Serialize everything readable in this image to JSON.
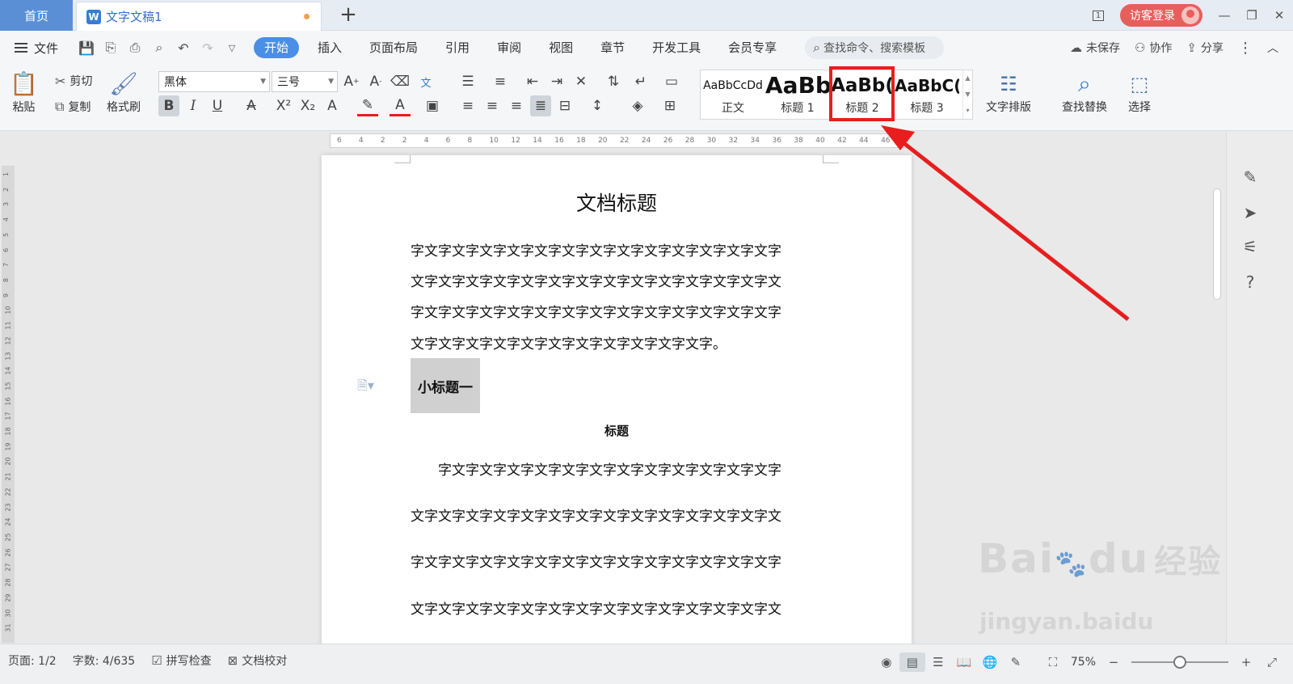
{
  "titlebar": {
    "home_tab": "首页",
    "doc_tab": "文字文稿1",
    "doc_logo": "W",
    "add_tab": "+",
    "window_count": "1",
    "login_label": "访客登录"
  },
  "menubar": {
    "file_label": "文件",
    "tabs": [
      "开始",
      "插入",
      "页面布局",
      "引用",
      "审阅",
      "视图",
      "章节",
      "开发工具",
      "会员专享"
    ],
    "search_placeholder": "查找命令、搜索模板",
    "unsaved_label": "未保存",
    "collab_label": "协作",
    "share_label": "分享"
  },
  "ribbon": {
    "paste_label": "粘贴",
    "cut_label": "剪切",
    "copy_label": "复制",
    "format_painter_label": "格式刷",
    "font_name": "黑体",
    "font_size": "三号",
    "styles": [
      {
        "preview": "AaBbCcDd",
        "name": "正文"
      },
      {
        "preview": "AaBb",
        "name": "标题 1"
      },
      {
        "preview": "AaBb(",
        "name": "标题 2"
      },
      {
        "preview": "AaBbC(",
        "name": "标题 3"
      }
    ],
    "text_layout_label": "文字排版",
    "find_replace_label": "查找替换",
    "select_label": "选择"
  },
  "ruler_ticks": [
    "6",
    "4",
    "2",
    "2",
    "4",
    "6",
    "8",
    "10",
    "12",
    "14",
    "16",
    "18",
    "20",
    "22",
    "24",
    "26",
    "28",
    "30",
    "32",
    "34",
    "36",
    "38",
    "40",
    "42",
    "44",
    "46"
  ],
  "vruler_ticks": [
    "1",
    "2",
    "3",
    "4",
    "5",
    "6",
    "7",
    "8",
    "9",
    "10",
    "11",
    "12",
    "13",
    "14",
    "15",
    "16",
    "17",
    "18",
    "19",
    "20",
    "21",
    "22",
    "23",
    "24",
    "25",
    "26",
    "27",
    "28",
    "29",
    "30",
    "31"
  ],
  "document": {
    "title": "文档标题",
    "para1": [
      "字文字文字文字文字文字文字文字文字文字文字文字文字文字",
      "文字文字文字文字文字文字文字文字文字文字文字文字文字文",
      "字文字文字文字文字文字文字文字文字文字文字文字文字文字",
      "文字文字文字文字文字文字文字文字文字文字文字。"
    ],
    "subheading": "小标题一",
    "center_label": "标题",
    "para2": [
      "字文字文字文字文字文字文字文字文字文字文字文字文字",
      "文字文字文字文字文字文字文字文字文字文字文字文字文字文",
      "字文字文字文字文字文字文字文字文字文字文字文字文字文字",
      "文字文字文字文字文字文字文字文字文字文字文字文字文字文"
    ]
  },
  "statusbar": {
    "page_label": "页面: 1/2",
    "word_count_label": "字数: 4/635",
    "spell_check_label": "拼写检查",
    "doc_check_label": "文档校对",
    "zoom_label": "75%",
    "zoom_minus": "−",
    "zoom_plus": "+"
  },
  "watermark": {
    "brand": "Bai",
    "brand2": "du",
    "cn": "经验",
    "url": "jingyan.baidu"
  },
  "colors": {
    "accent_blue": "#4a8ee6",
    "login_red": "#e5605d",
    "highlight_red": "#e81e1e",
    "subheading_bg": "#d0d0d0"
  }
}
